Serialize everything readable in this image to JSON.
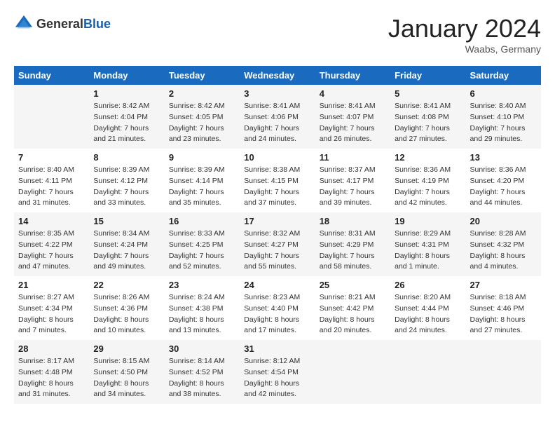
{
  "header": {
    "logo": {
      "general": "General",
      "blue": "Blue"
    },
    "title": "January 2024",
    "location": "Waabs, Germany"
  },
  "weekdays": [
    "Sunday",
    "Monday",
    "Tuesday",
    "Wednesday",
    "Thursday",
    "Friday",
    "Saturday"
  ],
  "weeks": [
    [
      {
        "day": "",
        "info": ""
      },
      {
        "day": "1",
        "info": "Sunrise: 8:42 AM\nSunset: 4:04 PM\nDaylight: 7 hours\nand 21 minutes."
      },
      {
        "day": "2",
        "info": "Sunrise: 8:42 AM\nSunset: 4:05 PM\nDaylight: 7 hours\nand 23 minutes."
      },
      {
        "day": "3",
        "info": "Sunrise: 8:41 AM\nSunset: 4:06 PM\nDaylight: 7 hours\nand 24 minutes."
      },
      {
        "day": "4",
        "info": "Sunrise: 8:41 AM\nSunset: 4:07 PM\nDaylight: 7 hours\nand 26 minutes."
      },
      {
        "day": "5",
        "info": "Sunrise: 8:41 AM\nSunset: 4:08 PM\nDaylight: 7 hours\nand 27 minutes."
      },
      {
        "day": "6",
        "info": "Sunrise: 8:40 AM\nSunset: 4:10 PM\nDaylight: 7 hours\nand 29 minutes."
      }
    ],
    [
      {
        "day": "7",
        "info": "Sunrise: 8:40 AM\nSunset: 4:11 PM\nDaylight: 7 hours\nand 31 minutes."
      },
      {
        "day": "8",
        "info": "Sunrise: 8:39 AM\nSunset: 4:12 PM\nDaylight: 7 hours\nand 33 minutes."
      },
      {
        "day": "9",
        "info": "Sunrise: 8:39 AM\nSunset: 4:14 PM\nDaylight: 7 hours\nand 35 minutes."
      },
      {
        "day": "10",
        "info": "Sunrise: 8:38 AM\nSunset: 4:15 PM\nDaylight: 7 hours\nand 37 minutes."
      },
      {
        "day": "11",
        "info": "Sunrise: 8:37 AM\nSunset: 4:17 PM\nDaylight: 7 hours\nand 39 minutes."
      },
      {
        "day": "12",
        "info": "Sunrise: 8:36 AM\nSunset: 4:19 PM\nDaylight: 7 hours\nand 42 minutes."
      },
      {
        "day": "13",
        "info": "Sunrise: 8:36 AM\nSunset: 4:20 PM\nDaylight: 7 hours\nand 44 minutes."
      }
    ],
    [
      {
        "day": "14",
        "info": "Sunrise: 8:35 AM\nSunset: 4:22 PM\nDaylight: 7 hours\nand 47 minutes."
      },
      {
        "day": "15",
        "info": "Sunrise: 8:34 AM\nSunset: 4:24 PM\nDaylight: 7 hours\nand 49 minutes."
      },
      {
        "day": "16",
        "info": "Sunrise: 8:33 AM\nSunset: 4:25 PM\nDaylight: 7 hours\nand 52 minutes."
      },
      {
        "day": "17",
        "info": "Sunrise: 8:32 AM\nSunset: 4:27 PM\nDaylight: 7 hours\nand 55 minutes."
      },
      {
        "day": "18",
        "info": "Sunrise: 8:31 AM\nSunset: 4:29 PM\nDaylight: 7 hours\nand 58 minutes."
      },
      {
        "day": "19",
        "info": "Sunrise: 8:29 AM\nSunset: 4:31 PM\nDaylight: 8 hours\nand 1 minute."
      },
      {
        "day": "20",
        "info": "Sunrise: 8:28 AM\nSunset: 4:32 PM\nDaylight: 8 hours\nand 4 minutes."
      }
    ],
    [
      {
        "day": "21",
        "info": "Sunrise: 8:27 AM\nSunset: 4:34 PM\nDaylight: 8 hours\nand 7 minutes."
      },
      {
        "day": "22",
        "info": "Sunrise: 8:26 AM\nSunset: 4:36 PM\nDaylight: 8 hours\nand 10 minutes."
      },
      {
        "day": "23",
        "info": "Sunrise: 8:24 AM\nSunset: 4:38 PM\nDaylight: 8 hours\nand 13 minutes."
      },
      {
        "day": "24",
        "info": "Sunrise: 8:23 AM\nSunset: 4:40 PM\nDaylight: 8 hours\nand 17 minutes."
      },
      {
        "day": "25",
        "info": "Sunrise: 8:21 AM\nSunset: 4:42 PM\nDaylight: 8 hours\nand 20 minutes."
      },
      {
        "day": "26",
        "info": "Sunrise: 8:20 AM\nSunset: 4:44 PM\nDaylight: 8 hours\nand 24 minutes."
      },
      {
        "day": "27",
        "info": "Sunrise: 8:18 AM\nSunset: 4:46 PM\nDaylight: 8 hours\nand 27 minutes."
      }
    ],
    [
      {
        "day": "28",
        "info": "Sunrise: 8:17 AM\nSunset: 4:48 PM\nDaylight: 8 hours\nand 31 minutes."
      },
      {
        "day": "29",
        "info": "Sunrise: 8:15 AM\nSunset: 4:50 PM\nDaylight: 8 hours\nand 34 minutes."
      },
      {
        "day": "30",
        "info": "Sunrise: 8:14 AM\nSunset: 4:52 PM\nDaylight: 8 hours\nand 38 minutes."
      },
      {
        "day": "31",
        "info": "Sunrise: 8:12 AM\nSunset: 4:54 PM\nDaylight: 8 hours\nand 42 minutes."
      },
      {
        "day": "",
        "info": ""
      },
      {
        "day": "",
        "info": ""
      },
      {
        "day": "",
        "info": ""
      }
    ]
  ]
}
